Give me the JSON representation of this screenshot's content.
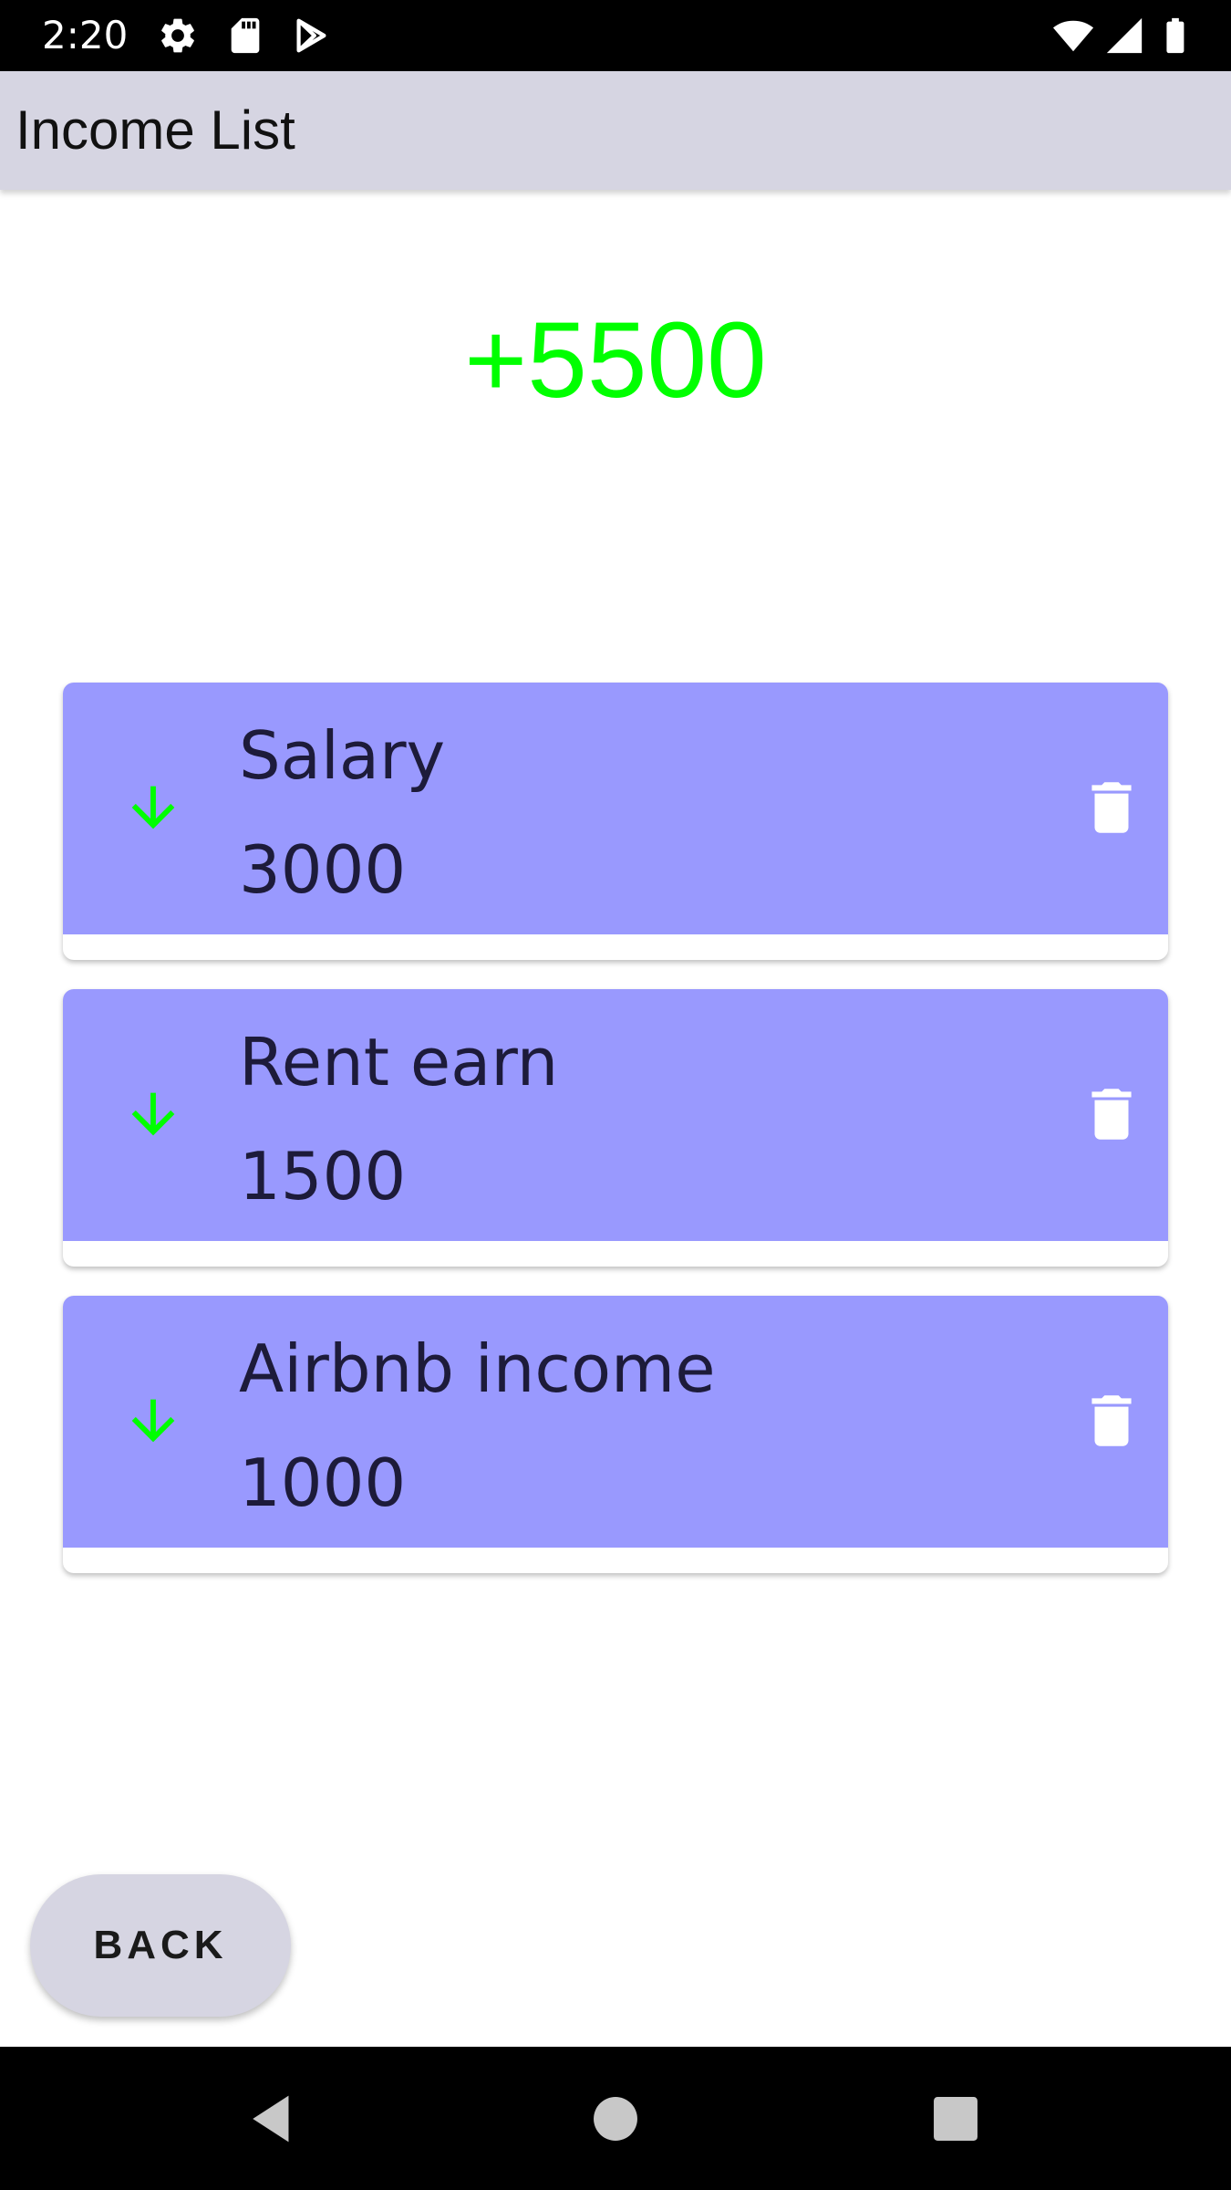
{
  "status_bar": {
    "time": "2:20",
    "icons": [
      "settings-icon",
      "sd-card-icon",
      "play-store-icon",
      "wifi-icon",
      "signal-icon",
      "battery-icon"
    ]
  },
  "app_bar": {
    "title": "Income List"
  },
  "total": {
    "value": "+5500",
    "color": "#00ff00"
  },
  "incomes": [
    {
      "name": "Salary",
      "amount": "3000",
      "icon": "arrow-down-icon"
    },
    {
      "name": "Rent earn",
      "amount": "1500",
      "icon": "arrow-down-icon"
    },
    {
      "name": "Airbnb income",
      "amount": "1000",
      "icon": "arrow-down-icon"
    }
  ],
  "colors": {
    "card": "#9999fe",
    "accent_green": "#00ff00",
    "app_bar": "#d6d5e2"
  },
  "actions": {
    "back_label": "BACK"
  },
  "nav_bar": {
    "buttons": [
      "back-triangle-icon",
      "home-circle-icon",
      "recents-square-icon"
    ]
  }
}
